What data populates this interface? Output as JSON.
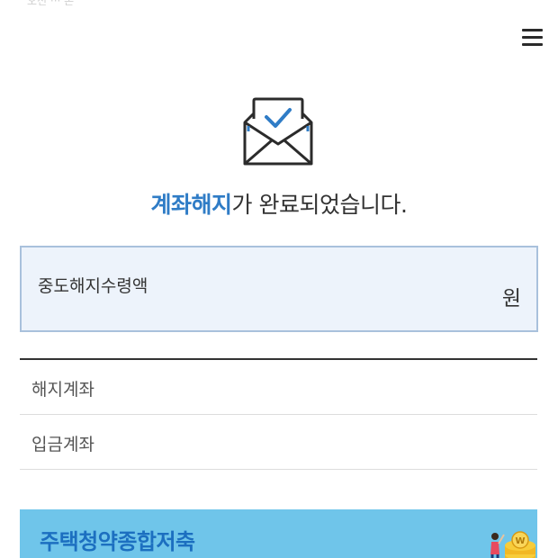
{
  "status_bar": {
    "left_text": "오전 ··· 온",
    "right_text": "··· ·  ············"
  },
  "header": {
    "menu_icon": "hamburger-menu-icon"
  },
  "result": {
    "icon": "envelope-check-icon",
    "title_accent": "계좌해지",
    "title_rest": "가 완료되었습니다."
  },
  "amount": {
    "label": "중도해지수령액",
    "value": "",
    "unit": "원"
  },
  "details": [
    {
      "label": "해지계좌",
      "value": ""
    },
    {
      "label": "입금계좌",
      "value": ""
    }
  ],
  "banner": {
    "title": "주택청약종합저축",
    "subtitle": "",
    "icon": "gold-coins-icon"
  },
  "colors": {
    "accent": "#2f7cc6",
    "amount_box_bg": "#edf3fb",
    "amount_box_border": "#a9c1dc",
    "banner_bg": "#6fc5ea",
    "banner_title": "#1c6fc0"
  }
}
